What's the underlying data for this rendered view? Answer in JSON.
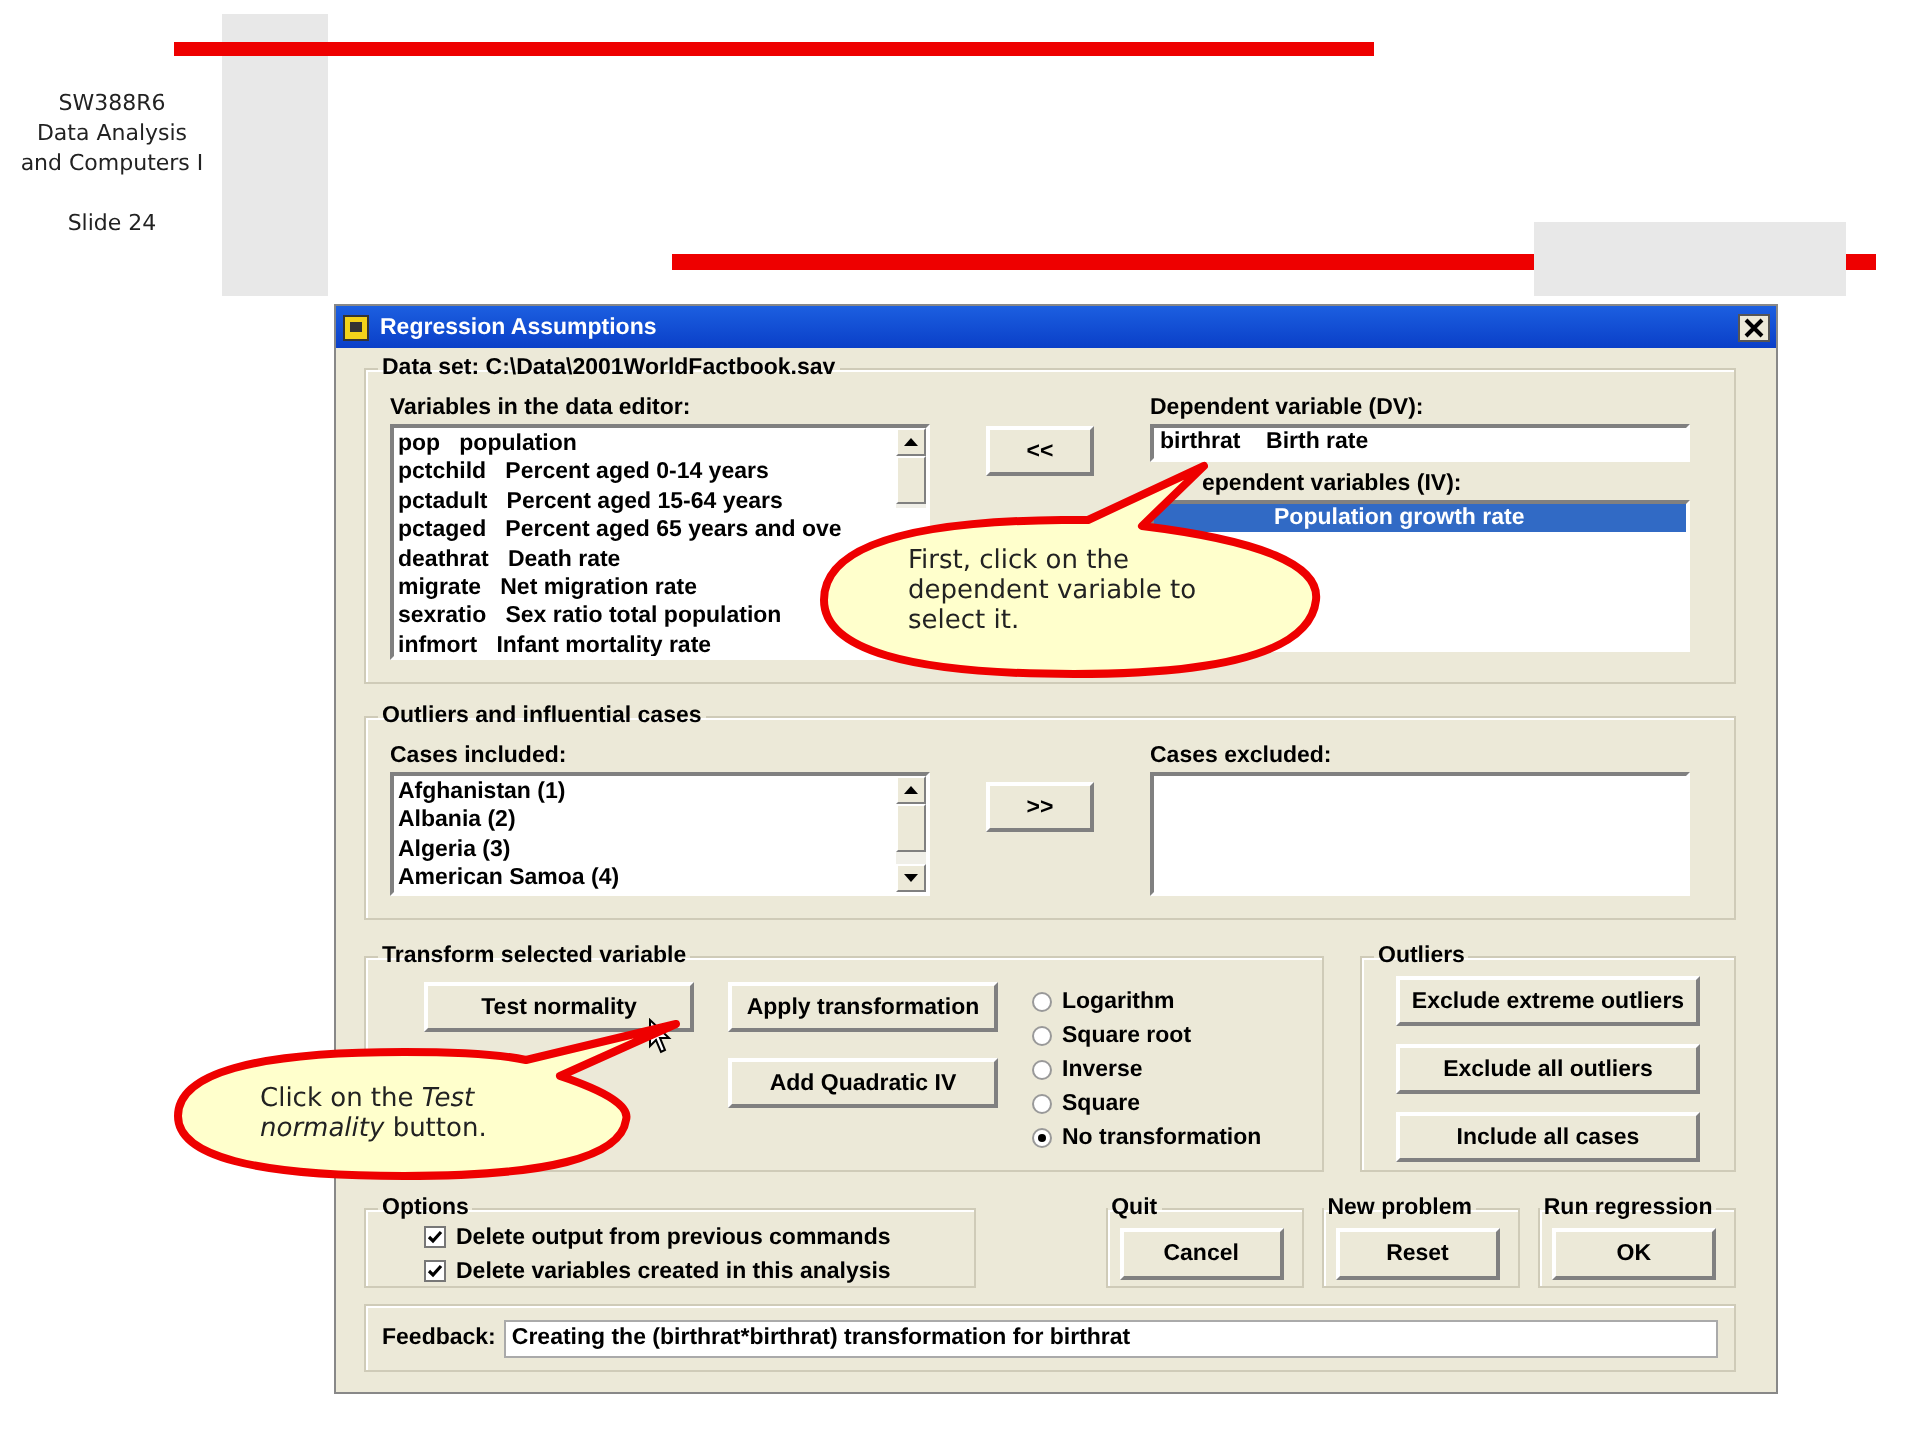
{
  "slide": {
    "course_lines": [
      "SW388R6",
      "Data Analysis",
      "and Computers I"
    ],
    "slide_number": "Slide 24"
  },
  "window": {
    "title": "Regression Assumptions"
  },
  "data_set": {
    "legend": "Data set: C:\\Data\\2001WorldFactbook.sav",
    "variables_label": "Variables in the data editor:",
    "variables": [
      {
        "name": "pop",
        "label": "population"
      },
      {
        "name": "pctchild",
        "label": "Percent aged 0-14 years"
      },
      {
        "name": "pctadult",
        "label": "Percent aged 15-64 years"
      },
      {
        "name": "pctaged",
        "label": "Percent aged 65 years and ove"
      },
      {
        "name": "deathrat",
        "label": "Death rate"
      },
      {
        "name": "migrate",
        "label": "Net migration rate"
      },
      {
        "name": "sexratio",
        "label": "Sex ratio total population"
      },
      {
        "name": "infmort",
        "label": "Infant mortality rate"
      }
    ],
    "move_button": "<<",
    "dv_label": "Dependent variable (DV):",
    "dv_value": "birthrat    Birth rate",
    "iv_label": "ependent variables (IV):",
    "iv_items": [
      {
        "text": "Population growth rate",
        "selected": true
      }
    ]
  },
  "outliers_cases": {
    "legend": "Outliers and influential cases",
    "included_label": "Cases included:",
    "included": [
      "Afghanistan (1)",
      "Albania (2)",
      "Algeria (3)",
      "American Samoa (4)"
    ],
    "move_button": ">>",
    "excluded_label": "Cases excluded:"
  },
  "transform": {
    "legend": "Transform selected variable",
    "buttons": [
      "Test normality",
      "Apply transformation",
      "Add Quadratic IV"
    ],
    "options": [
      {
        "label": "Logarithm",
        "selected": false
      },
      {
        "label": "Square root",
        "selected": false
      },
      {
        "label": "Inverse",
        "selected": false
      },
      {
        "label": "Square",
        "selected": false
      },
      {
        "label": "No transformation",
        "selected": true
      }
    ]
  },
  "outliers": {
    "legend": "Outliers",
    "buttons": [
      "Exclude extreme outliers",
      "Exclude all outliers",
      "Include all cases"
    ]
  },
  "options": {
    "legend": "Options",
    "checkboxes": [
      {
        "label": "Delete output from previous commands",
        "checked": true
      },
      {
        "label": "Delete variables created in this analysis",
        "checked": true
      }
    ]
  },
  "actions": [
    {
      "legend": "Quit",
      "button": "Cancel"
    },
    {
      "legend": "New problem",
      "button": "Reset"
    },
    {
      "legend": "Run regression",
      "button": "OK"
    }
  ],
  "feedback": {
    "label": "Feedback:",
    "value": "Creating the (birthrat*birthrat) transformation for birthrat"
  },
  "callouts": [
    {
      "text": "First, click on the dependent variable to select it."
    },
    {
      "text": "Click on the *Test normality* button."
    }
  ]
}
